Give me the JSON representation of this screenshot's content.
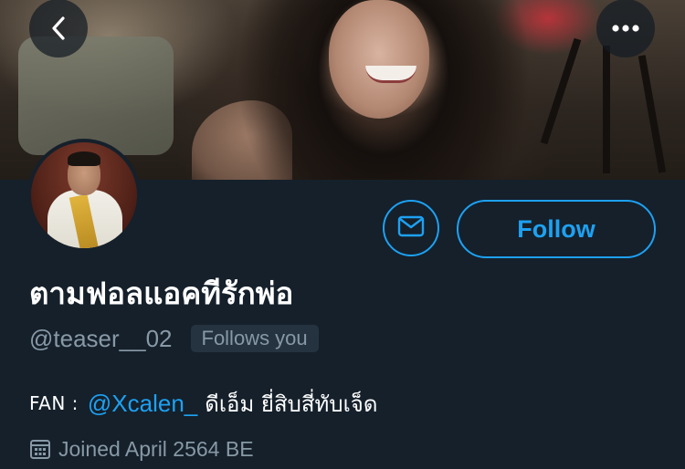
{
  "profile": {
    "display_name": "ตามฟอลแอคทีรักพ่อ",
    "handle": "@teaser__02",
    "follows_you_label": "Follows you",
    "bio": {
      "prefix": "FAN :",
      "mention": "@Xcalen_",
      "text": "ดีเอ็ม ยี่สิบสี่ทับเจ็ด"
    },
    "joined": "Joined April 2564 BE"
  },
  "actions": {
    "follow_label": "Follow",
    "back_icon": "chevron-left-icon",
    "more_icon": "more-horizontal-icon",
    "message_icon": "envelope-icon"
  },
  "colors": {
    "background": "#15202b",
    "accent": "#1da1f2",
    "secondary_text": "#8899a6",
    "badge_background": "#253341"
  }
}
